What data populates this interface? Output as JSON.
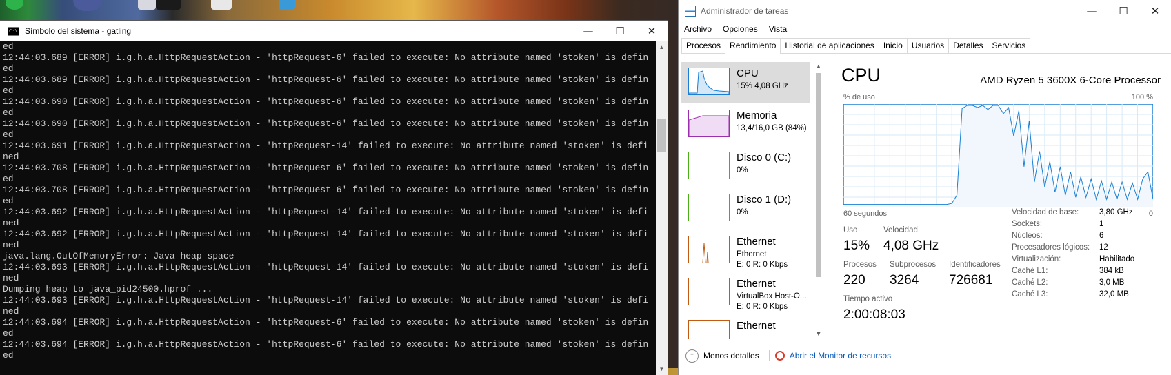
{
  "cmd": {
    "title": "Símbolo del sistema - gatling",
    "icon_text": "C:\\",
    "controls": {
      "minimize": "—",
      "maximize": "☐",
      "close": "✕"
    },
    "lines": [
      "ed",
      "12:44:03.689 [ERROR] i.g.h.a.HttpRequestAction - 'httpRequest-6' failed to execute: No attribute named 'stoken' is defin",
      "ed",
      "12:44:03.689 [ERROR] i.g.h.a.HttpRequestAction - 'httpRequest-6' failed to execute: No attribute named 'stoken' is defin",
      "ed",
      "12:44:03.690 [ERROR] i.g.h.a.HttpRequestAction - 'httpRequest-6' failed to execute: No attribute named 'stoken' is defin",
      "ed",
      "12:44:03.690 [ERROR] i.g.h.a.HttpRequestAction - 'httpRequest-6' failed to execute: No attribute named 'stoken' is defin",
      "ed",
      "12:44:03.691 [ERROR] i.g.h.a.HttpRequestAction - 'httpRequest-14' failed to execute: No attribute named 'stoken' is defi",
      "ned",
      "12:44:03.708 [ERROR] i.g.h.a.HttpRequestAction - 'httpRequest-6' failed to execute: No attribute named 'stoken' is defin",
      "ed",
      "12:44:03.708 [ERROR] i.g.h.a.HttpRequestAction - 'httpRequest-6' failed to execute: No attribute named 'stoken' is defin",
      "ed",
      "12:44:03.692 [ERROR] i.g.h.a.HttpRequestAction - 'httpRequest-14' failed to execute: No attribute named 'stoken' is defi",
      "ned",
      "12:44:03.692 [ERROR] i.g.h.a.HttpRequestAction - 'httpRequest-14' failed to execute: No attribute named 'stoken' is defi",
      "ned",
      "java.lang.OutOfMemoryError: Java heap space",
      "12:44:03.693 [ERROR] i.g.h.a.HttpRequestAction - 'httpRequest-14' failed to execute: No attribute named 'stoken' is defi",
      "ned",
      "Dumping heap to java_pid24500.hprof ...",
      "12:44:03.693 [ERROR] i.g.h.a.HttpRequestAction - 'httpRequest-14' failed to execute: No attribute named 'stoken' is defi",
      "ned",
      "12:44:03.694 [ERROR] i.g.h.a.HttpRequestAction - 'httpRequest-6' failed to execute: No attribute named 'stoken' is defin",
      "ed",
      "12:44:03.694 [ERROR] i.g.h.a.HttpRequestAction - 'httpRequest-6' failed to execute: No attribute named 'stoken' is defin",
      "ed"
    ]
  },
  "taskmgr": {
    "title": "Administrador de tareas",
    "menu": [
      "Archivo",
      "Opciones",
      "Vista"
    ],
    "tabs": [
      "Procesos",
      "Rendimiento",
      "Historial de aplicaciones",
      "Inicio",
      "Usuarios",
      "Detalles",
      "Servicios"
    ],
    "active_tab": "Rendimiento",
    "sidebar": [
      {
        "name": "CPU",
        "sub1": "15% 4,08 GHz",
        "sub2": "",
        "color": "#1a7fd4"
      },
      {
        "name": "Memoria",
        "sub1": "13,4/16,0 GB (84%)",
        "sub2": "",
        "color": "#9b2fae"
      },
      {
        "name": "Disco 0 (C:)",
        "sub1": "0%",
        "sub2": "",
        "color": "#4caf1a"
      },
      {
        "name": "Disco 1 (D:)",
        "sub1": "0%",
        "sub2": "",
        "color": "#4caf1a"
      },
      {
        "name": "Ethernet",
        "sub1": "Ethernet",
        "sub2": "E: 0 R: 0 Kbps",
        "color": "#c25a14"
      },
      {
        "name": "Ethernet",
        "sub1": "VirtualBox Host-O...",
        "sub2": "E: 0 R: 0 Kbps",
        "color": "#c25a14"
      },
      {
        "name": "Ethernet",
        "sub1": "",
        "sub2": "",
        "color": "#c25a14"
      }
    ],
    "main": {
      "heading": "CPU",
      "model": "AMD Ryzen 5 3600X 6-Core Processor",
      "graph_top_left": "% de uso",
      "graph_top_right": "100 %",
      "graph_bottom_left": "60 segundos",
      "graph_bottom_right": "0",
      "stats": {
        "uso_label": "Uso",
        "uso_value": "15%",
        "velocidad_label": "Velocidad",
        "velocidad_value": "4,08 GHz",
        "procesos_label": "Procesos",
        "procesos_value": "220",
        "subprocesos_label": "Subprocesos",
        "subprocesos_value": "3264",
        "identificadores_label": "Identificadores",
        "identificadores_value": "726681",
        "tiempo_label": "Tiempo activo",
        "tiempo_value": "2:00:08:03"
      },
      "details": [
        {
          "k": "Velocidad de base:",
          "v": "3,80 GHz"
        },
        {
          "k": "Sockets:",
          "v": "1"
        },
        {
          "k": "Núcleos:",
          "v": "6"
        },
        {
          "k": "Procesadores lógicos:",
          "v": "12"
        },
        {
          "k": "Virtualización:",
          "v": "Habilitado"
        },
        {
          "k": "Caché L1:",
          "v": "384 kB"
        },
        {
          "k": "Caché L2:",
          "v": "3,0 MB"
        },
        {
          "k": "Caché L3:",
          "v": "32,0 MB"
        }
      ]
    },
    "footer": {
      "fewer_details": "Menos detalles",
      "resource_monitor": "Abrir el Monitor de recursos"
    },
    "controls": {
      "minimize": "—",
      "maximize": "☐",
      "close": "✕"
    },
    "cpu_usage_series": [
      3,
      3,
      3,
      3,
      3,
      3,
      3,
      3,
      3,
      3,
      3,
      3,
      3,
      3,
      3,
      3,
      3,
      3,
      3,
      3,
      3,
      4,
      12,
      97,
      100,
      100,
      98,
      100,
      96,
      100,
      100,
      92,
      98,
      70,
      95,
      40,
      85,
      25,
      55,
      20,
      45,
      15,
      40,
      12,
      35,
      10,
      30,
      10,
      28,
      8,
      26,
      8,
      25,
      8,
      25,
      8,
      24,
      8,
      28,
      35,
      8
    ]
  }
}
